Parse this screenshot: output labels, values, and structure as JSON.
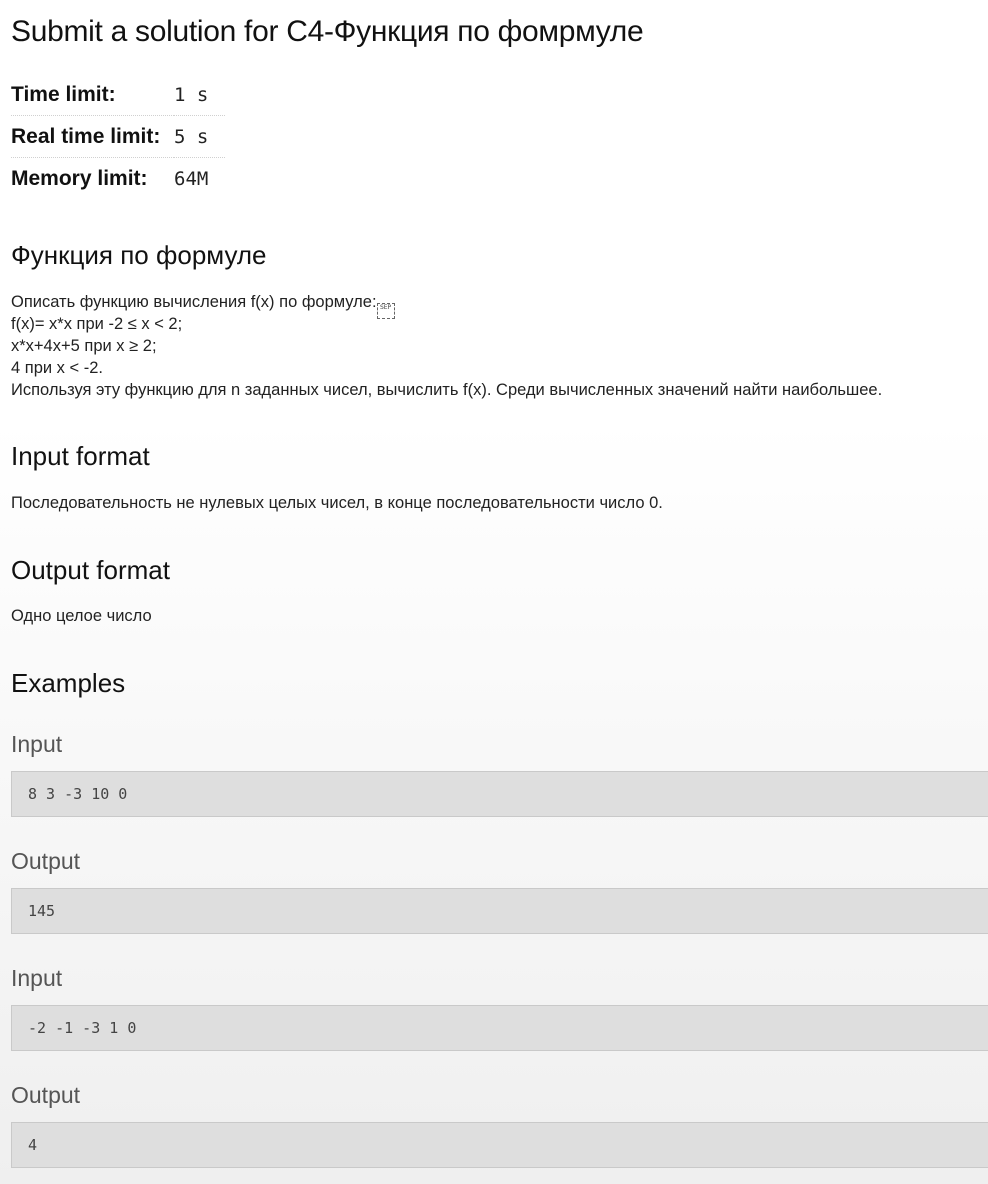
{
  "page": {
    "title": "Submit a solution for C4-Функция по фомрмуле"
  },
  "limits": [
    {
      "label": "Time limit:",
      "value": "1 s"
    },
    {
      "label": "Real time limit:",
      "value": "5 s"
    },
    {
      "label": "Memory limit:",
      "value": "64M"
    }
  ],
  "problem": {
    "heading": "Функция по формуле",
    "statement_lines": [
      "Описать функцию вычисления f(x) по формуле:",
      "f(x)= x*x при -2 ≤ x < 2;",
      "x*x+4x+5 при x ≥ 2;",
      "4 при x < -2.",
      "Используя эту функцию для n заданных чисел, вычислить f(x). Среди вычисленных значений найти наибольшее."
    ],
    "sep_glyph": "SEP"
  },
  "input_format": {
    "heading": "Input format",
    "text": "Последовательность не нулевых целых чисел, в конце последовательности число 0."
  },
  "output_format": {
    "heading": "Output format",
    "text": "Одно целое число"
  },
  "examples": {
    "heading": "Examples",
    "items": [
      {
        "input_label": "Input",
        "input": "8 3 -3 10 0",
        "output_label": "Output",
        "output": "145"
      },
      {
        "input_label": "Input",
        "input": "-2 -1 -3 1 0",
        "output_label": "Output",
        "output": "4"
      }
    ]
  }
}
